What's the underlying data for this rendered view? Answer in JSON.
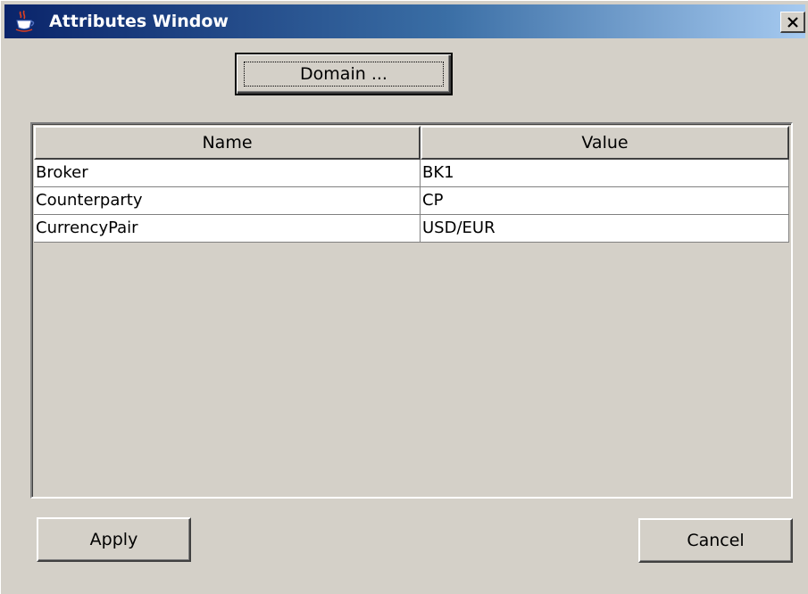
{
  "window": {
    "title": "Attributes Window",
    "close_label": "X"
  },
  "toolbar": {
    "domain_label": "Domain ..."
  },
  "table": {
    "columns": [
      "Name",
      "Value"
    ],
    "rows": [
      [
        "Broker",
        "BK1"
      ],
      [
        "Counterparty",
        "CP"
      ],
      [
        "CurrencyPair",
        "USD/EUR"
      ]
    ]
  },
  "footer": {
    "apply_label": "Apply",
    "cancel_label": "Cancel"
  },
  "icons": {
    "app": "java-cup-icon",
    "close": "close-icon"
  },
  "colors": {
    "titlebar_start": "#0a246a",
    "titlebar_end": "#a6caf0",
    "window_bg": "#d4d0c8",
    "cell_bg": "#ffffff"
  }
}
